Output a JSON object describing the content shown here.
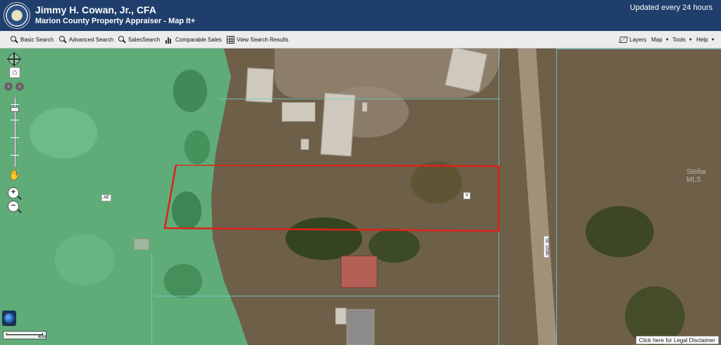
{
  "header": {
    "title": "Jimmy H. Cowan, Jr., CFA",
    "subtitle": "Marion County Property Appraiser - Map It+",
    "updated": "Updated every 24 hours"
  },
  "toolbar": {
    "left": [
      {
        "label": "Basic Search",
        "icon": "search-icon"
      },
      {
        "label": "Advanced Search",
        "icon": "search-icon"
      },
      {
        "label": "SalesSearch",
        "icon": "search-icon"
      },
      {
        "label": "Comparable Sales",
        "icon": "bar-chart-icon"
      },
      {
        "label": "View Search Results",
        "icon": "table-icon"
      }
    ],
    "right": [
      {
        "label": "Layers",
        "icon": "layers-icon"
      },
      {
        "label": "Map",
        "icon": "chevron-down-icon"
      },
      {
        "label": "Tools",
        "icon": "chevron-down-icon"
      },
      {
        "label": "Help",
        "icon": "chevron-down-icon"
      }
    ]
  },
  "map": {
    "zone_label": "AE",
    "parcel_marker": "X",
    "road_label": "SE 100th",
    "watermark": "Stellar MLS",
    "scale_label": "40m",
    "disclaimer": "Click here for Legal Disclaimer",
    "subject_outline_color": "#e0211b",
    "parcel_line_color": "#6fd3d0",
    "flood_zone_color": "#5fb07c"
  },
  "controls": {
    "zoom_in": "+",
    "zoom_out": "−",
    "home": "⌂",
    "pan_left": "‹",
    "pan_right": "›"
  }
}
